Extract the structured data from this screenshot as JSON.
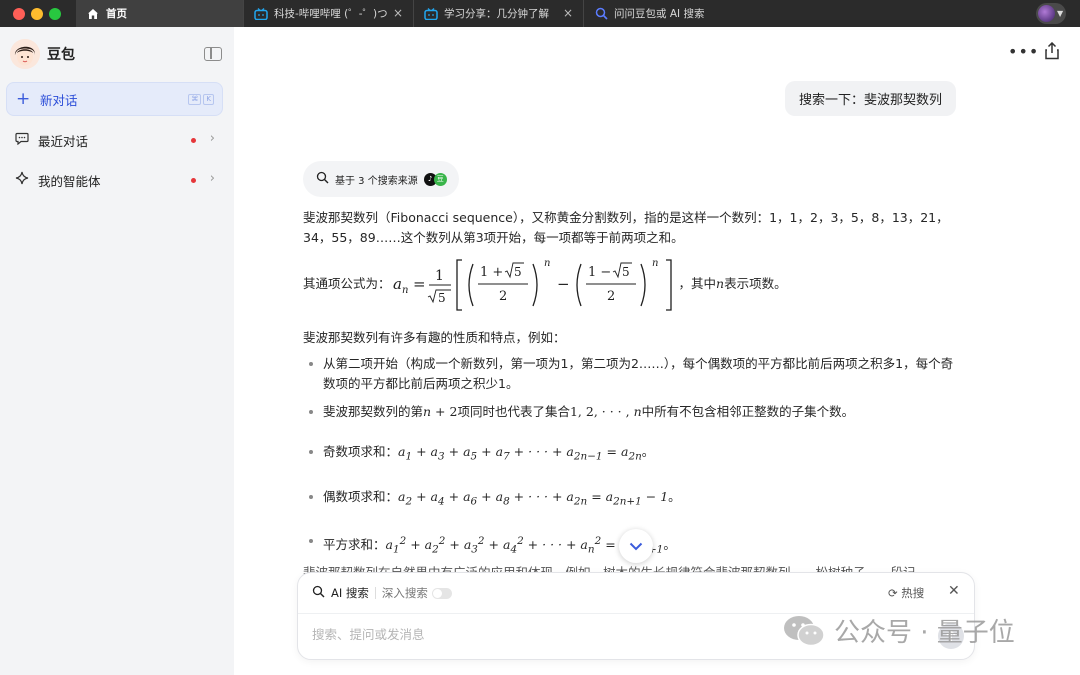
{
  "tabs": [
    {
      "title": "首页",
      "icon": "home-icon"
    },
    {
      "title": "科技-哔哩哔哩 (゜-゜)つ",
      "icon": "bilibili-icon"
    },
    {
      "title": "学习分享：几分钟了解",
      "icon": "bilibili-icon"
    },
    {
      "title": "问问豆包或 AI 搜索",
      "icon": "ai-search-icon"
    }
  ],
  "sidebar": {
    "brand": "豆包",
    "new_chat": "新对话",
    "new_chat_shortcut": [
      "⌘",
      "K"
    ],
    "items": [
      {
        "label": "最近对话",
        "icon": "chat-bubble-icon"
      },
      {
        "label": "我的智能体",
        "icon": "sparkle-icon"
      }
    ]
  },
  "conversation": {
    "user_message": "搜索一下：斐波那契数列",
    "source_pill": "基于 3 个搜索来源",
    "para1": "斐波那契数列（Fibonacci sequence），又称黄金分割数列，指的是这样一个数列：1，1，2，3，5，8，13，21，34，55，89……这个数列从第3项开始，每一项都等于前两项之和。",
    "formula_prefix": "其通项公式为：",
    "formula_suffix": "，其中",
    "formula_suffix2": "表示项数。",
    "para2": "斐波那契数列有许多有趣的性质和特点，例如：",
    "bullet1": "从第二项开始（构成一个新数列，第一项为1，第二项为2……），每个偶数项的平方都比前后两项之积多1，每个奇数项的平方都比前后两项之积少1。",
    "bullet2_a": "斐波那契数列的第",
    "bullet2_b": "项同时也代表了集合",
    "bullet2_c": "中所有不包含相邻正整数的子集个数。",
    "bullet3_label": "奇数项求和：",
    "bullet4_label": "偶数项求和：",
    "bullet5_label": "平方求和：",
    "fade_text": "斐波那契数列在自然界中有广泛的应用和体现，例如，树木的生长规律符合斐波那契数列……松树种子……段记"
  },
  "composer": {
    "ai_search": "AI 搜索",
    "deep_search": "深入搜索",
    "hot_search": "热搜",
    "placeholder": "搜索、提问或发消息"
  },
  "watermark": {
    "text": "公众号 · 量子位"
  }
}
